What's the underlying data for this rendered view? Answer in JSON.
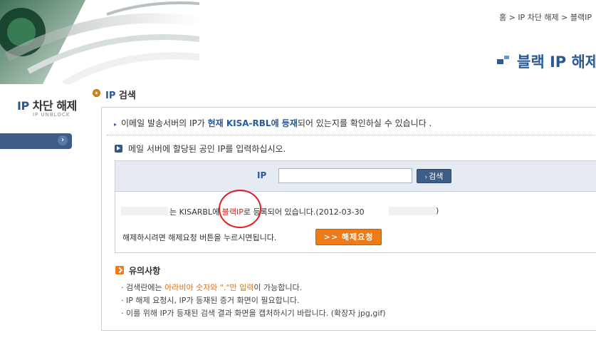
{
  "breadcrumb": "홈 > IP 차단 해제 > 블랙IP",
  "page_title": "블랙 IP 해제",
  "sidebar": {
    "title_ip": "IP",
    "title_rest": " 차단 해제",
    "subtitle": "IP UNBLOCK",
    "tab_arrow": "›"
  },
  "section": {
    "title_ip": "IP",
    "title_rest": " 검색"
  },
  "intro": {
    "marker": "▸",
    "before": "이메일 발송서버의 IP가 ",
    "highlight": "현재 KISA-RBL에 등재",
    "after": "되어 있는지를 확인하실 수 있습니다 ."
  },
  "instruction": "메일 서버에 할당된 공인 IP를 입력하십시오.",
  "search": {
    "label": "IP",
    "value": "",
    "button_arrow": "›",
    "button_label": "검색"
  },
  "result": {
    "prefix": "는 KISARBL에 ",
    "highlight": "블랙IP",
    "suffix": "로 등록되어 있습니다.(2012-03-30 ",
    "tail": ")"
  },
  "release": {
    "text": "해제하시려면 해제요청 버튼을 누르시면됩니다.",
    "button_label": ">> 해제요청"
  },
  "notes": {
    "title": "유의사항",
    "items": [
      {
        "before": "· 검색란에는 ",
        "highlight": "아라비아 숫자와 \".\"만 입력",
        "after": "이 가능합니다."
      },
      {
        "before": "· IP 해제 요청시, IP가 등재된 증거 화면이 필요합니다.",
        "highlight": "",
        "after": ""
      },
      {
        "before": "· 이를 위해 IP가 등재된 검색 결과 화면을 캡처하시기 바랍니다. (확장자 jpg,gif)",
        "highlight": "",
        "after": ""
      }
    ]
  },
  "colors": {
    "accent_blue": "#2a5a96",
    "nav_blue": "#3d5d88",
    "orange": "#ee7a18",
    "red": "#d82020"
  }
}
